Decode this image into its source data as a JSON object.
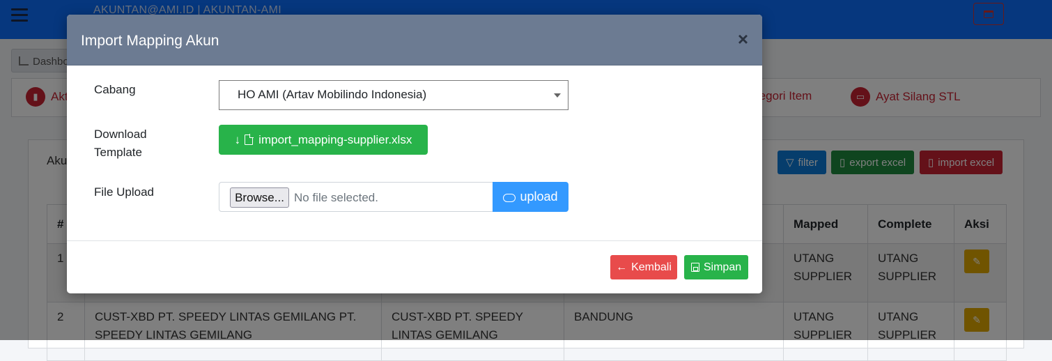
{
  "topbar": {
    "user": "AKUNTAN@AMI.ID | AKUNTAN-AMI"
  },
  "breadcrumb": {
    "label": "Dashbo"
  },
  "nav": {
    "items": [
      {
        "label": "Akt",
        "icon": "chart-icon"
      },
      {
        "label": "tegori Item",
        "icon": "tag-icon"
      },
      {
        "label": "Ayat Silang STL",
        "icon": "wallet-icon"
      }
    ]
  },
  "card": {
    "title": "Aku",
    "buttons": {
      "filter": "filter",
      "export": "export excel",
      "import": "import excel"
    },
    "table": {
      "headers": [
        "#",
        "Mapped",
        "Complete",
        "Aksi"
      ],
      "rows": [
        {
          "no": "1",
          "c1": "",
          "c2": "",
          "c3": "",
          "mapped": "UTANG SUPPLIER",
          "complete": "UTANG SUPPLIER"
        },
        {
          "no": "2",
          "c1": "CUST-XBD PT. SPEEDY LINTAS GEMILANG PT. SPEEDY LINTAS GEMILANG",
          "c2": "CUST-XBD PT. SPEEDY LINTAS GEMILANG",
          "c3": "BANDUNG",
          "mapped": "UTANG SUPPLIER",
          "complete": "UTANG SUPPLIER"
        }
      ]
    }
  },
  "modal": {
    "title": "Import Mapping Akun",
    "close": "×",
    "fields": {
      "cabang_label": "Cabang",
      "cabang_value": "HO AMI (Artav Mobilindo Indonesia)",
      "template_label_1": "Download",
      "template_label_2": "Template",
      "template_file": "import_mapping-supplier.xlsx",
      "upload_label": "File Upload",
      "browse": "Browse...",
      "file_status": "No file selected.",
      "upload_button": "upload"
    },
    "footer": {
      "back": "Kembali",
      "save": "Simpan"
    }
  },
  "colors": {
    "topbar": "#0d6efd",
    "modal_header": "#6c7b92",
    "success": "#28b34a",
    "danger": "#e84b4b",
    "primary": "#3399ff",
    "warning": "#e0a800"
  }
}
